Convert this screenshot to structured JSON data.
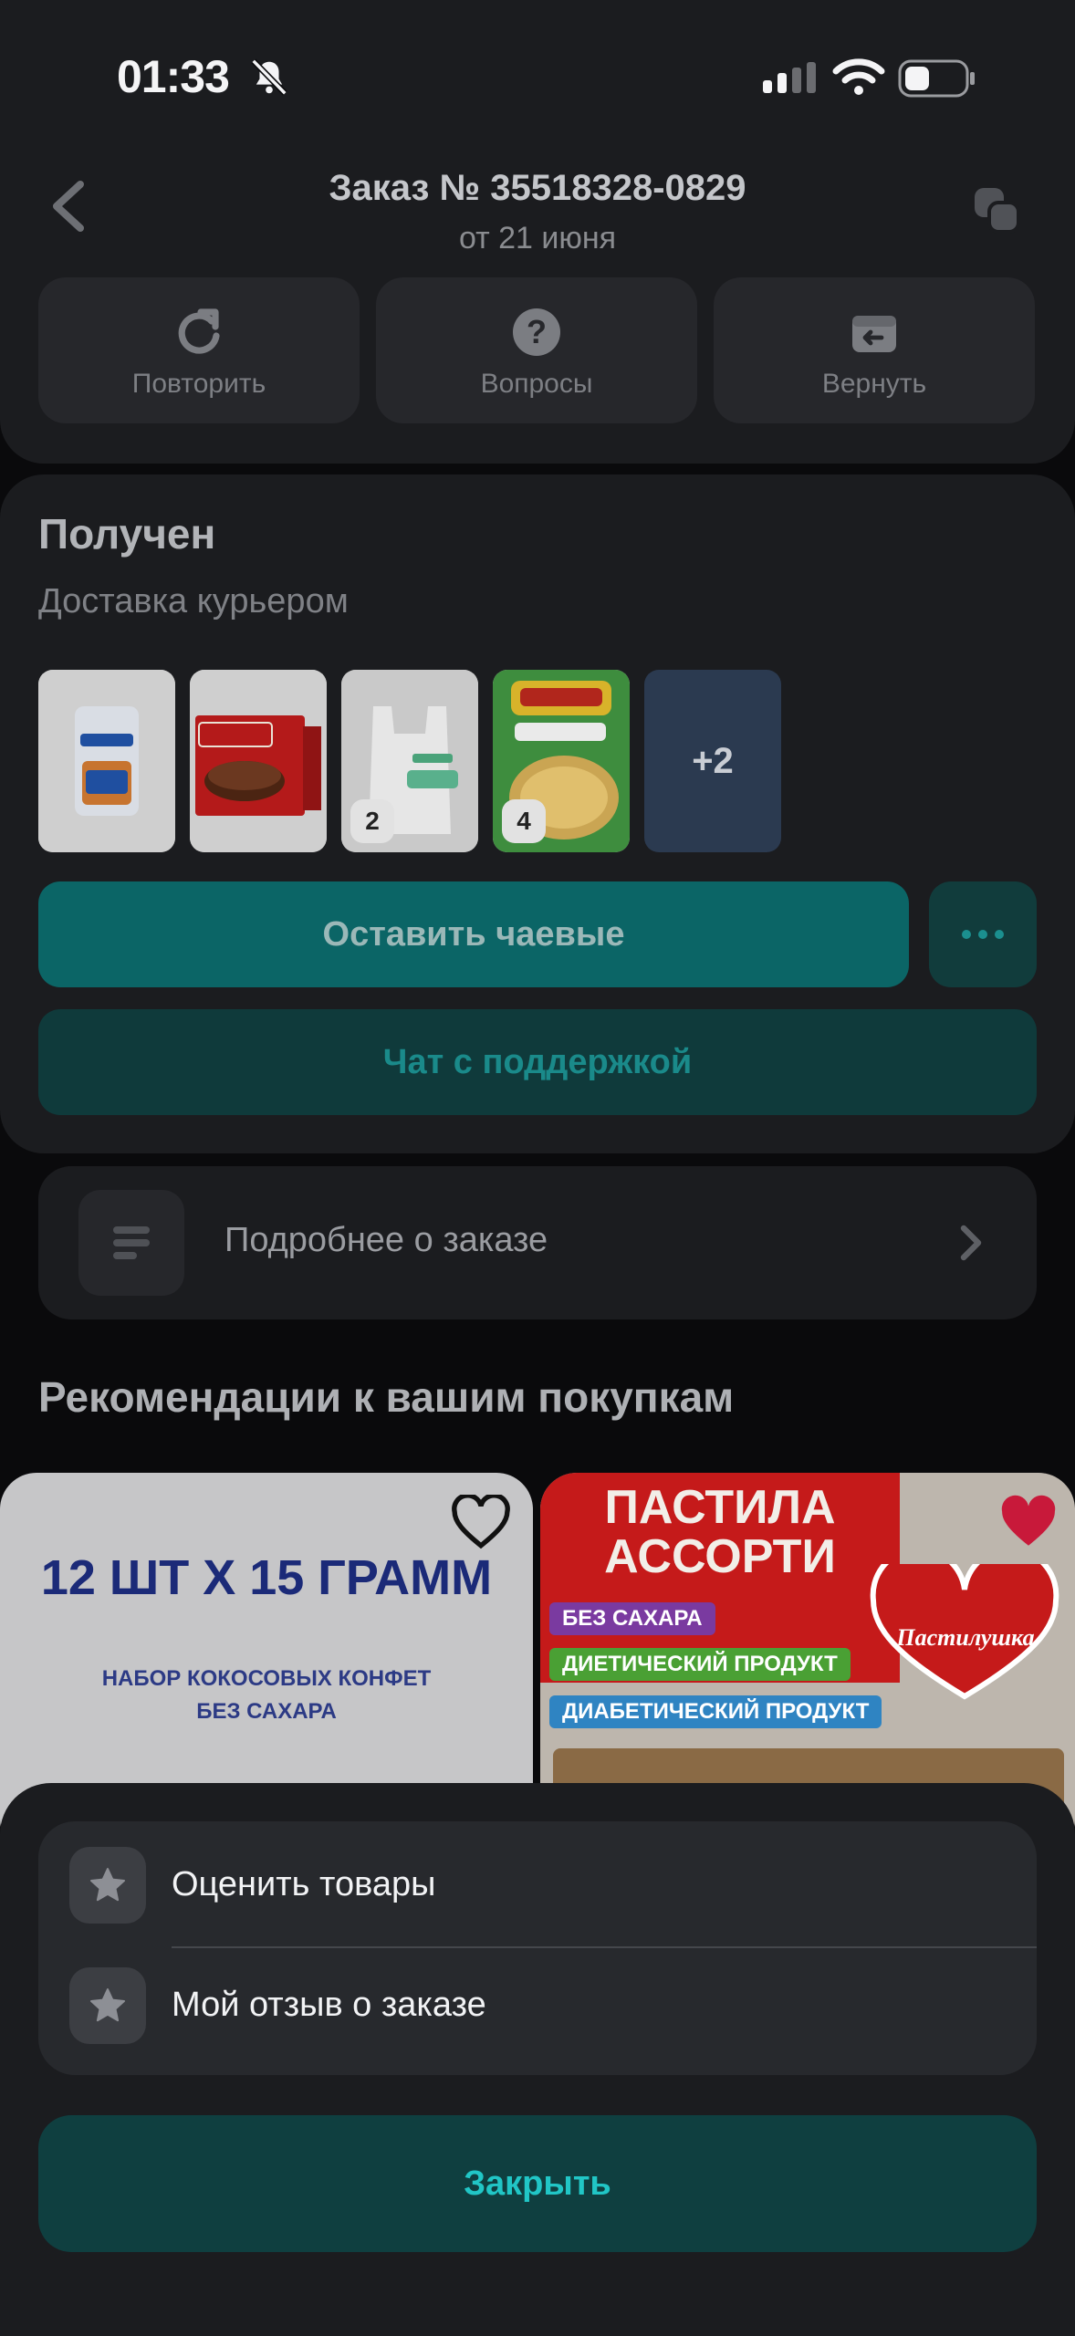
{
  "status_bar": {
    "time": "01:33",
    "icons": [
      "bell-slash-icon",
      "cellular-signal-icon",
      "wifi-icon",
      "battery-icon"
    ]
  },
  "header": {
    "title": "Заказ № 35518328-0829",
    "date": "от 21 июня",
    "back_icon": "chevron-left-icon",
    "copy_icon": "copy-icon",
    "actions": [
      {
        "label": "Повторить",
        "icon": "repeat-icon"
      },
      {
        "label": "Вопросы",
        "icon": "question-icon"
      },
      {
        "label": "Вернуть",
        "icon": "return-box-icon"
      }
    ]
  },
  "order_status": {
    "title": "Получен",
    "delivery": "Доставка курьером",
    "items": [
      {
        "name": "Harry's American Sandwich",
        "badge": ""
      },
      {
        "name": "Orion Choco-Pie",
        "badge": ""
      },
      {
        "name": "Ozon fresh пакет",
        "badge": "2"
      },
      {
        "name": "Роллтон",
        "badge": "4"
      }
    ],
    "more_count": "+2",
    "tips_button": "Оставить чаевые",
    "more_button_icon": "ellipsis-icon",
    "support_button": "Чат с поддержкой"
  },
  "details": {
    "label": "Подробнее о заказе",
    "icon": "list-icon",
    "chevron_icon": "chevron-right-icon"
  },
  "recommendations": {
    "title": "Рекомендации к вашим покупкам",
    "products": [
      {
        "headline_a": "12 ШТ",
        "headline_b": "X 15 ГРАММ",
        "line1": "НАБОР КОКОСОВЫХ КОНФЕТ",
        "line2": "БЕЗ САХАРА",
        "favorite": false
      },
      {
        "headline1": "ПАСТИЛА",
        "headline2": "АССОРТИ",
        "brand": "Пастилушка",
        "tags": [
          "БЕЗ САХАРА",
          "ДИЕТИЧЕСКИЙ ПРОДУКТ",
          "ДИАБЕТИЧЕСКИЙ ПРОДУКТ"
        ],
        "favorite": true
      }
    ]
  },
  "bottom_sheet": {
    "items": [
      {
        "label": "Оценить товары",
        "icon": "star-icon"
      },
      {
        "label": "Мой отзыв о заказе",
        "icon": "star-icon"
      }
    ],
    "close_button": "Закрыть"
  },
  "colors": {
    "accent": "#21c6c6",
    "tips_button": "#0b6566",
    "background": "#0a0a0c",
    "card": "#1b1c1f",
    "favorite": "#c8193a"
  }
}
